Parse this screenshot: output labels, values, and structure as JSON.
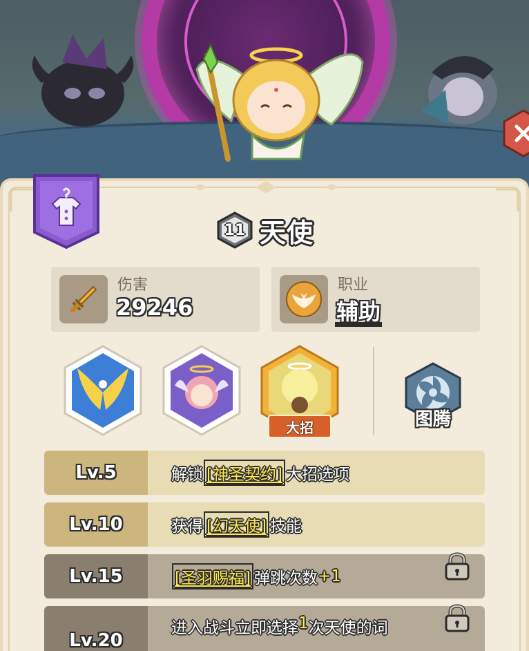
{
  "hero": {
    "level": "11",
    "name": "天使"
  },
  "stats": {
    "damage_label": "伤害",
    "damage_value": "29246",
    "class_label": "职业",
    "class_value": "辅助"
  },
  "skills": {
    "ultimate_tag": "大招",
    "totem_label": "图腾"
  },
  "level_rows": [
    {
      "level": "Lv.5",
      "pre": "解锁",
      "keyword": "[神圣契约]",
      "post": "大招选项",
      "locked": false
    },
    {
      "level": "Lv.10",
      "pre": "获得",
      "keyword": "[幻天使]",
      "post": "技能",
      "locked": false
    },
    {
      "level": "Lv.15",
      "pre": "",
      "keyword": "[圣羽赐福]",
      "post": "弹跳次数",
      "bonus": "+1",
      "locked": true
    },
    {
      "level": "Lv.20",
      "pre": "进入战斗立即选择",
      "count": "1",
      "post": "次天使的词",
      "locked": true
    }
  ],
  "colors": {
    "panel_bg": "#f3ecdd",
    "row_unlocked": "#e7dcb3",
    "row_locked": "#b5aa97",
    "keyword": "#ffe84a",
    "ult_tag": "#d7602a",
    "portal": "#b43aa6"
  },
  "icons": [
    "sword-icon",
    "wings-emblem-icon",
    "shirt-icon",
    "lock-icon",
    "totem-swirl-icon",
    "close-icon"
  ]
}
